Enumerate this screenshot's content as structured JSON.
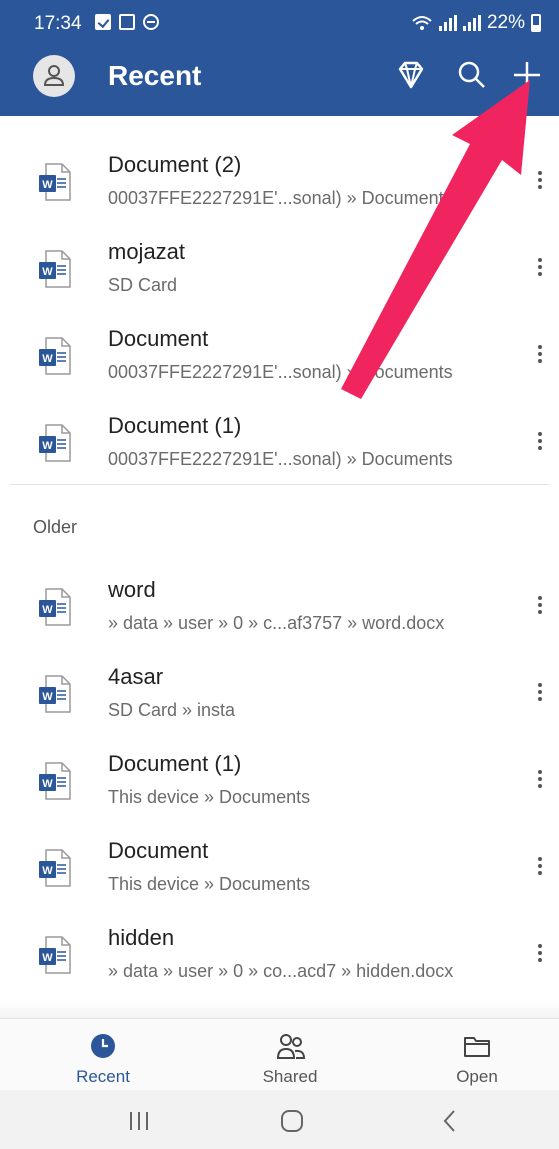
{
  "status_bar": {
    "time": "17:34",
    "battery": "22%"
  },
  "app_bar": {
    "title": "Recent",
    "icons": [
      "avatar-icon",
      "premium-diamond-icon",
      "search-icon",
      "plus-icon"
    ]
  },
  "recent_items": [
    {
      "title": "Document (2)",
      "path": "00037FFE2227291E'...sonal) » Documents"
    },
    {
      "title": "mojazat",
      "path": "SD Card"
    },
    {
      "title": "Document",
      "path": "00037FFE2227291E'...sonal) » Documents"
    },
    {
      "title": "Document (1)",
      "path": "00037FFE2227291E'...sonal) » Documents"
    }
  ],
  "older_label": "Older",
  "older_items": [
    {
      "title": "word",
      "path": " » data » user » 0 » c...af3757 » word.docx"
    },
    {
      "title": "4asar",
      "path": "SD Card » insta"
    },
    {
      "title": "Document (1)",
      "path": "This device » Documents"
    },
    {
      "title": "Document",
      "path": "This device » Documents"
    },
    {
      "title": "hidden",
      "path": " » data » user » 0 » co...acd7 » hidden.docx"
    }
  ],
  "bottom_nav": {
    "recent": "Recent",
    "shared": "Shared",
    "open": "Open"
  },
  "colors": {
    "brand": "#2b579a",
    "annotation_arrow": "#f0245e",
    "word_icon": "#2b579a"
  }
}
